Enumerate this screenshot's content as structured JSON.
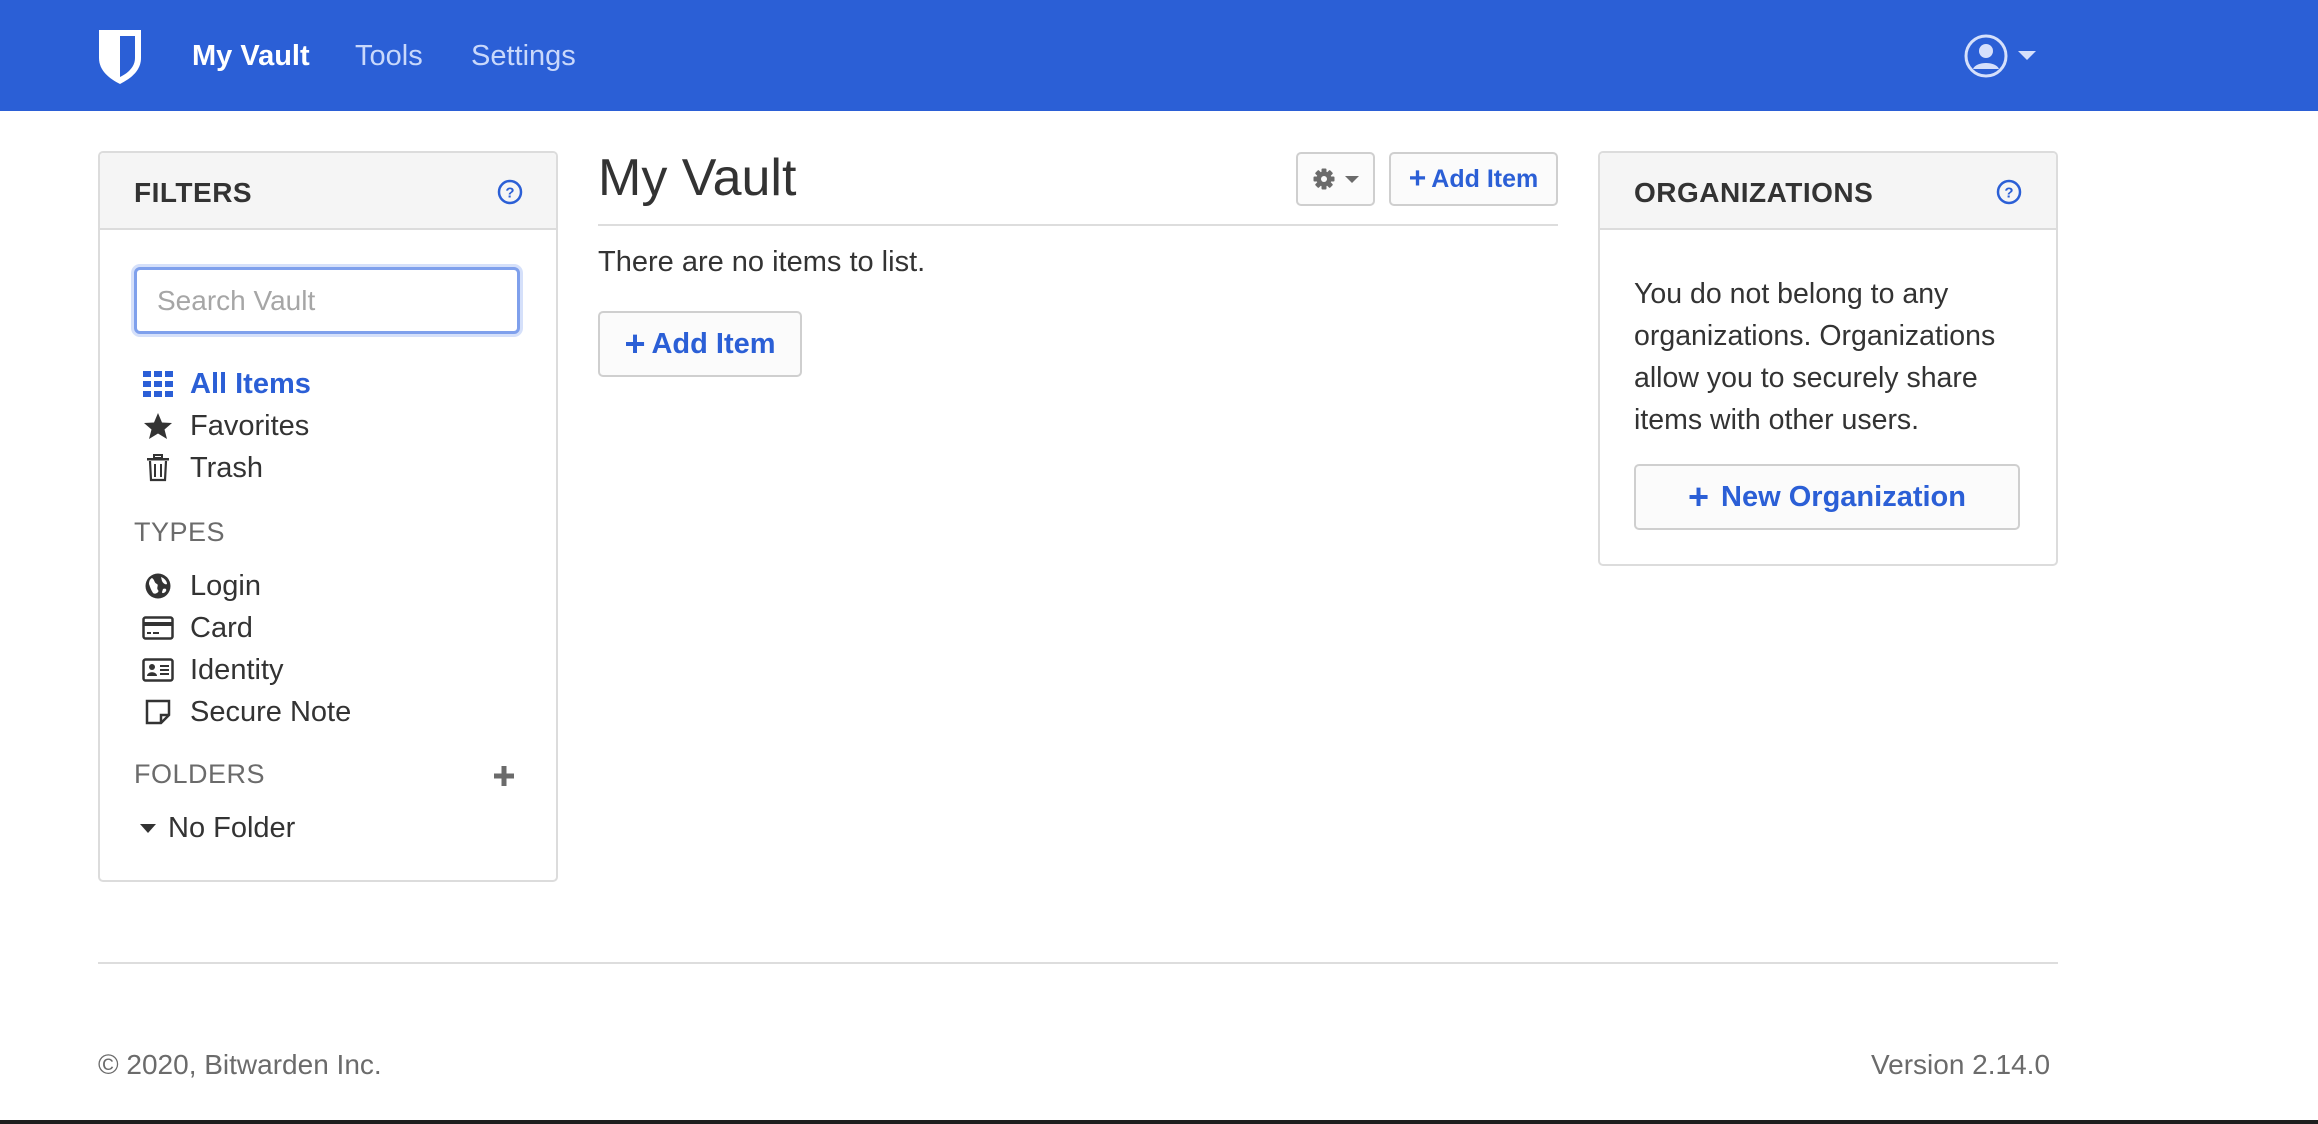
{
  "nav": {
    "links": [
      "My Vault",
      "Tools",
      "Settings"
    ],
    "accent_color": "#2b5fd6",
    "logo_icon": "bitwarden-shield-icon",
    "account_icon": "user-circle-icon"
  },
  "filters": {
    "title": "FILTERS",
    "search_placeholder": "Search Vault",
    "items": [
      {
        "label": "All Items",
        "icon": "grid-icon",
        "active": true
      },
      {
        "label": "Favorites",
        "icon": "star-icon",
        "active": false
      },
      {
        "label": "Trash",
        "icon": "trash-icon",
        "active": false
      }
    ],
    "types_label": "TYPES",
    "types": [
      {
        "label": "Login",
        "icon": "globe-icon"
      },
      {
        "label": "Card",
        "icon": "credit-card-icon"
      },
      {
        "label": "Identity",
        "icon": "id-card-icon"
      },
      {
        "label": "Secure Note",
        "icon": "sticky-note-icon"
      }
    ],
    "folders_label": "FOLDERS",
    "folders": [
      {
        "label": "No Folder",
        "icon": "caret-down-icon"
      }
    ]
  },
  "main": {
    "title": "My Vault",
    "add_item_label": "Add Item",
    "empty_text": "There are no items to list.",
    "empty_add_label": "Add Item"
  },
  "organizations": {
    "title": "ORGANIZATIONS",
    "description": "You do not belong to any organizations. Organizations allow you to securely share items with other users.",
    "new_label": "New Organization"
  },
  "footer": {
    "copyright": "© 2020, Bitwarden Inc.",
    "version": "Version 2.14.0"
  }
}
